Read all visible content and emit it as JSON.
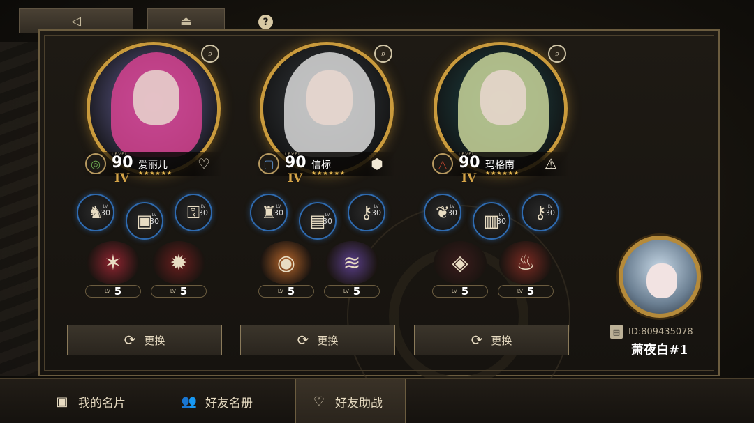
{
  "nav": {
    "back_glyph": "◁",
    "home_glyph": "⏏",
    "help_glyph": "?"
  },
  "characters": [
    {
      "level_tag": "LEVEL",
      "level": "90",
      "name": "爱丽儿",
      "tier": "IV",
      "stars": "★★★★★★",
      "class_glyph": "◎",
      "class_color": "#6aa84f",
      "affinity_glyph": "♡",
      "hair_color": "#d6428f",
      "bg_color": "#6f6aa8",
      "items": [
        {
          "glyph": "♞",
          "lv_label": "LV",
          "lv": "30"
        },
        {
          "glyph": "▣",
          "lv_label": "LV",
          "lv": "30"
        },
        {
          "glyph": "⚿",
          "lv_label": "LV",
          "lv": "30"
        }
      ],
      "skills": [
        {
          "glyph": "✶",
          "color": "#8f2430",
          "lv_label": "LV",
          "lv": "5"
        },
        {
          "glyph": "✹",
          "color": "#6a1e1e",
          "lv_label": "LV",
          "lv": "5"
        }
      ],
      "change_label": "更换",
      "change_glyph": "⟳"
    },
    {
      "level_tag": "LEVEL",
      "level": "90",
      "name": "信标",
      "tier": "IV",
      "stars": "★★★★★★",
      "class_glyph": "▢",
      "class_color": "#5b8fc9",
      "affinity_glyph": "⬢",
      "hair_color": "#d9d9d9",
      "bg_color": "#3a3f44",
      "items": [
        {
          "glyph": "♜",
          "lv_label": "LV",
          "lv": "30"
        },
        {
          "glyph": "▤",
          "lv_label": "LV",
          "lv": "30"
        },
        {
          "glyph": "⚷",
          "lv_label": "LV",
          "lv": "30"
        }
      ],
      "skills": [
        {
          "glyph": "◉",
          "color": "#b5652a",
          "lv_label": "LV",
          "lv": "5"
        },
        {
          "glyph": "≋",
          "color": "#5a3f8a",
          "lv_label": "LV",
          "lv": "5"
        }
      ],
      "change_label": "更换",
      "change_glyph": "⟳"
    },
    {
      "level_tag": "LEVEL",
      "level": "90",
      "name": "玛格南",
      "tier": "IV",
      "stars": "★★★★★★",
      "class_glyph": "△",
      "class_color": "#c0462f",
      "affinity_glyph": "⚠",
      "hair_color": "#c9d59a",
      "bg_color": "#1f4a4c",
      "items": [
        {
          "glyph": "❦",
          "lv_label": "LV",
          "lv": "30"
        },
        {
          "glyph": "▥",
          "lv_label": "LV",
          "lv": "30"
        },
        {
          "glyph": "⚷",
          "lv_label": "LV",
          "lv": "30"
        }
      ],
      "skills": [
        {
          "glyph": "◈",
          "color": "#3a1c1c",
          "lv_label": "LV",
          "lv": "5"
        },
        {
          "glyph": "♨",
          "color": "#7a2a22",
          "lv_label": "LV",
          "lv": "5"
        }
      ],
      "change_label": "更换",
      "change_glyph": "⟳"
    }
  ],
  "player": {
    "id_label": "ID:809435078",
    "name": "萧夜白#1",
    "id_glyph": "▤"
  },
  "tabs": [
    {
      "label": "我的名片",
      "glyph": "▣",
      "active": false
    },
    {
      "label": "好友名册",
      "glyph": "👥",
      "active": false
    },
    {
      "label": "好友助战",
      "glyph": "♡",
      "active": true
    }
  ]
}
